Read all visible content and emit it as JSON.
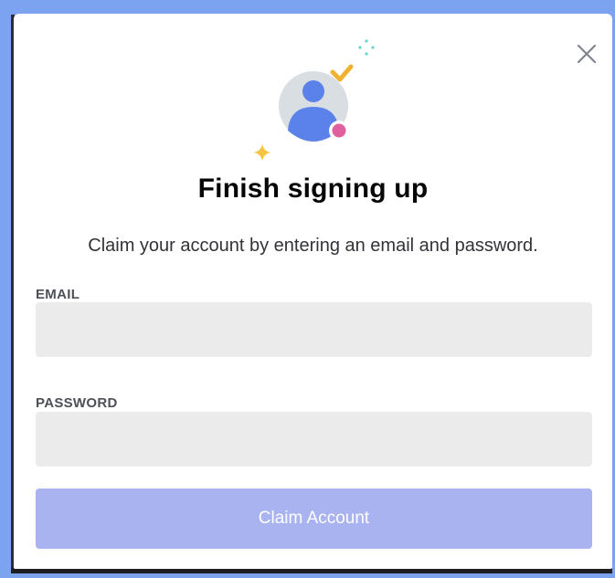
{
  "modal": {
    "title": "Finish signing up",
    "subtitle": "Claim your account by entering an email and password.",
    "close_icon": "close-icon"
  },
  "illustration": {
    "icons": [
      "avatar-icon",
      "checkmark-icon",
      "status-dot-icon",
      "sparkle-icon"
    ],
    "colors": {
      "avatar_bg": "#d9dee3",
      "avatar_figure": "#5b82e8",
      "checkmark": "#f0b232",
      "status_dot": "#e0609e",
      "sparkle_yellow": "#f5c542",
      "sparkle_teal": "#62d6c8"
    }
  },
  "form": {
    "email_label": "EMAIL",
    "email_value": "",
    "password_label": "PASSWORD",
    "password_value": "",
    "submit_label": "Claim Account"
  },
  "colors": {
    "page_bg": "#7ba3f0",
    "input_bg": "#ebebeb",
    "button_bg": "#a9b3f0",
    "title": "#060607",
    "label": "#4e5058"
  }
}
